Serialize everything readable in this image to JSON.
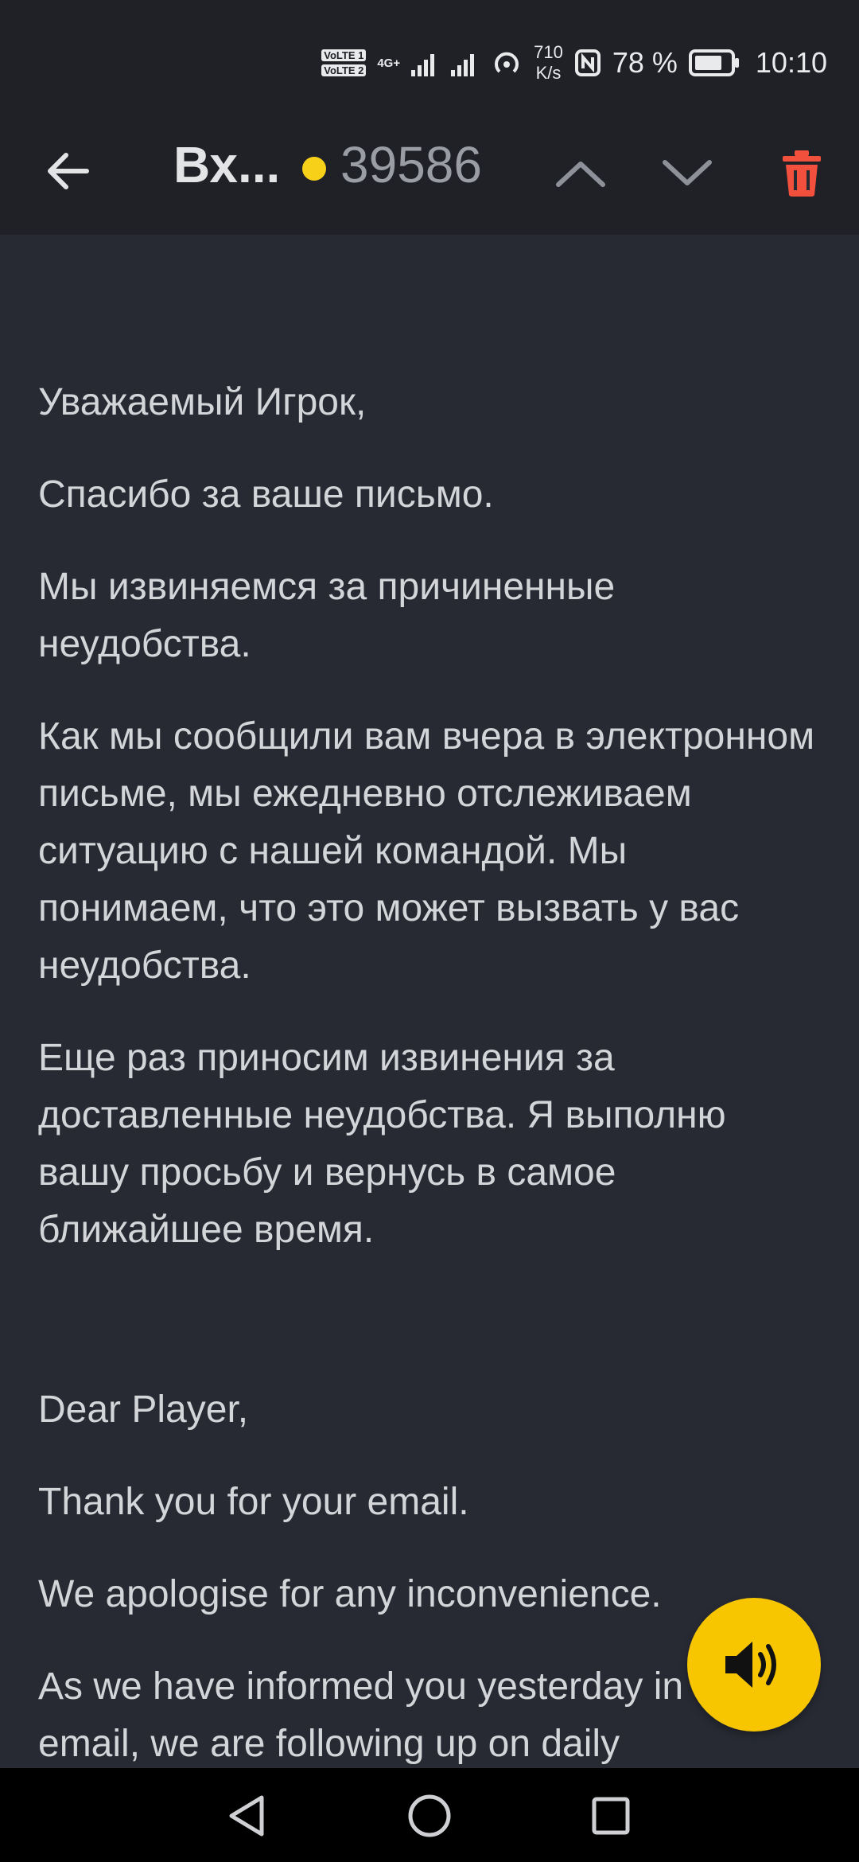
{
  "status_bar": {
    "sim1": "VoLTE 1",
    "sim2": "VoLTE 2",
    "network_type": "4G+",
    "speed_value": "710",
    "speed_unit": "K/s",
    "battery_percent": "78 %",
    "time": "10:10"
  },
  "app_bar": {
    "title": "Вх...",
    "unread_count": "39586",
    "back_icon": "arrow-left-icon",
    "prev_icon": "chevron-up-icon",
    "next_icon": "chevron-down-icon",
    "delete_icon": "trash-icon",
    "delete_color": "#f0503c",
    "dot_color": "#f7d019"
  },
  "message": {
    "paragraphs": [
      "Уважаемый Игрок,",
      "Спасибо за ваше письмо.",
      "Мы извиняемся за причиненные неудобства.",
      "Как мы сообщили вам вчера в электронном письме, мы ежедневно отслеживаем ситуацию с нашей командой. Мы понимаем, что это может вызвать у вас неудобства.",
      "Еще раз приносим извинения за доставленные неудобства. Я выполню вашу просьбу и вернусь в самое ближайшее время.",
      "Dear Player,",
      "Thank you for your email.",
      "We apologise for any inconvenience.",
      "As we have informed you yesterday in the email, we are following up on daily"
    ]
  },
  "fab": {
    "icon": "speaker-icon",
    "color": "#f7c600"
  },
  "nav_bar": {
    "back_icon": "nav-back-icon",
    "home_icon": "nav-home-icon",
    "recents_icon": "nav-recents-icon"
  }
}
